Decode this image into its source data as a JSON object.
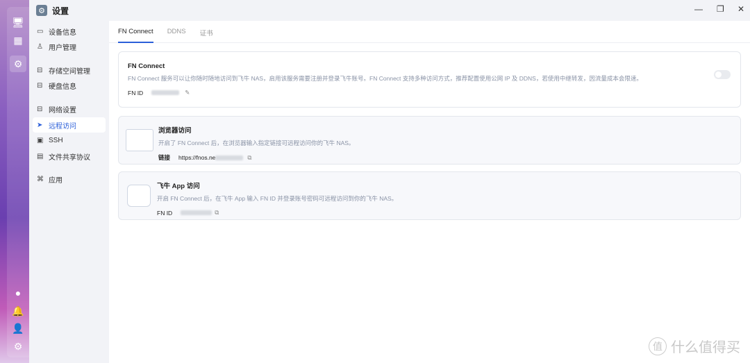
{
  "window": {
    "title": "设置"
  },
  "sidebar": {
    "items": [
      {
        "label": "设备信息",
        "icon": "▭"
      },
      {
        "label": "用户管理",
        "icon": "♙"
      },
      {
        "label": "存储空间管理",
        "icon": "⊟"
      },
      {
        "label": "硬盘信息",
        "icon": "⊟"
      },
      {
        "label": "网络设置",
        "icon": "⊟"
      },
      {
        "label": "远程访问",
        "icon": "➤"
      },
      {
        "label": "SSH",
        "icon": "▣"
      },
      {
        "label": "文件共享协议",
        "icon": "▤"
      },
      {
        "label": "应用",
        "icon": "⌘"
      }
    ]
  },
  "tabs": [
    "FN Connect",
    "DDNS",
    "证书"
  ],
  "fn_connect": {
    "title": "FN Connect",
    "desc": "FN Connect 服务可以让你随时随地访问到飞牛 NAS，启用该服务需要注册并登录飞牛账号。FN Connect 支持多种访问方式，推荐配置使用公网 IP 及 DDNS，若使用中继转发，因流量成本会限速。",
    "id_label": "FN ID",
    "enabled": false
  },
  "browser": {
    "title": "浏览器访问",
    "desc": "开启了 FN Connect 后，在浏览器输入指定链接可远程访问你的飞牛 NAS。",
    "link_label": "链接",
    "link": "https://fnos.ne"
  },
  "app": {
    "title": "飞牛 App 访问",
    "desc": "开启 FN Connect 后，在飞牛 App 输入 FN ID 并登录账号密码可远程访问到你的飞牛 NAS。",
    "id_label": "FN ID"
  },
  "watermark": {
    "icon": "值",
    "text": "什么值得买"
  }
}
